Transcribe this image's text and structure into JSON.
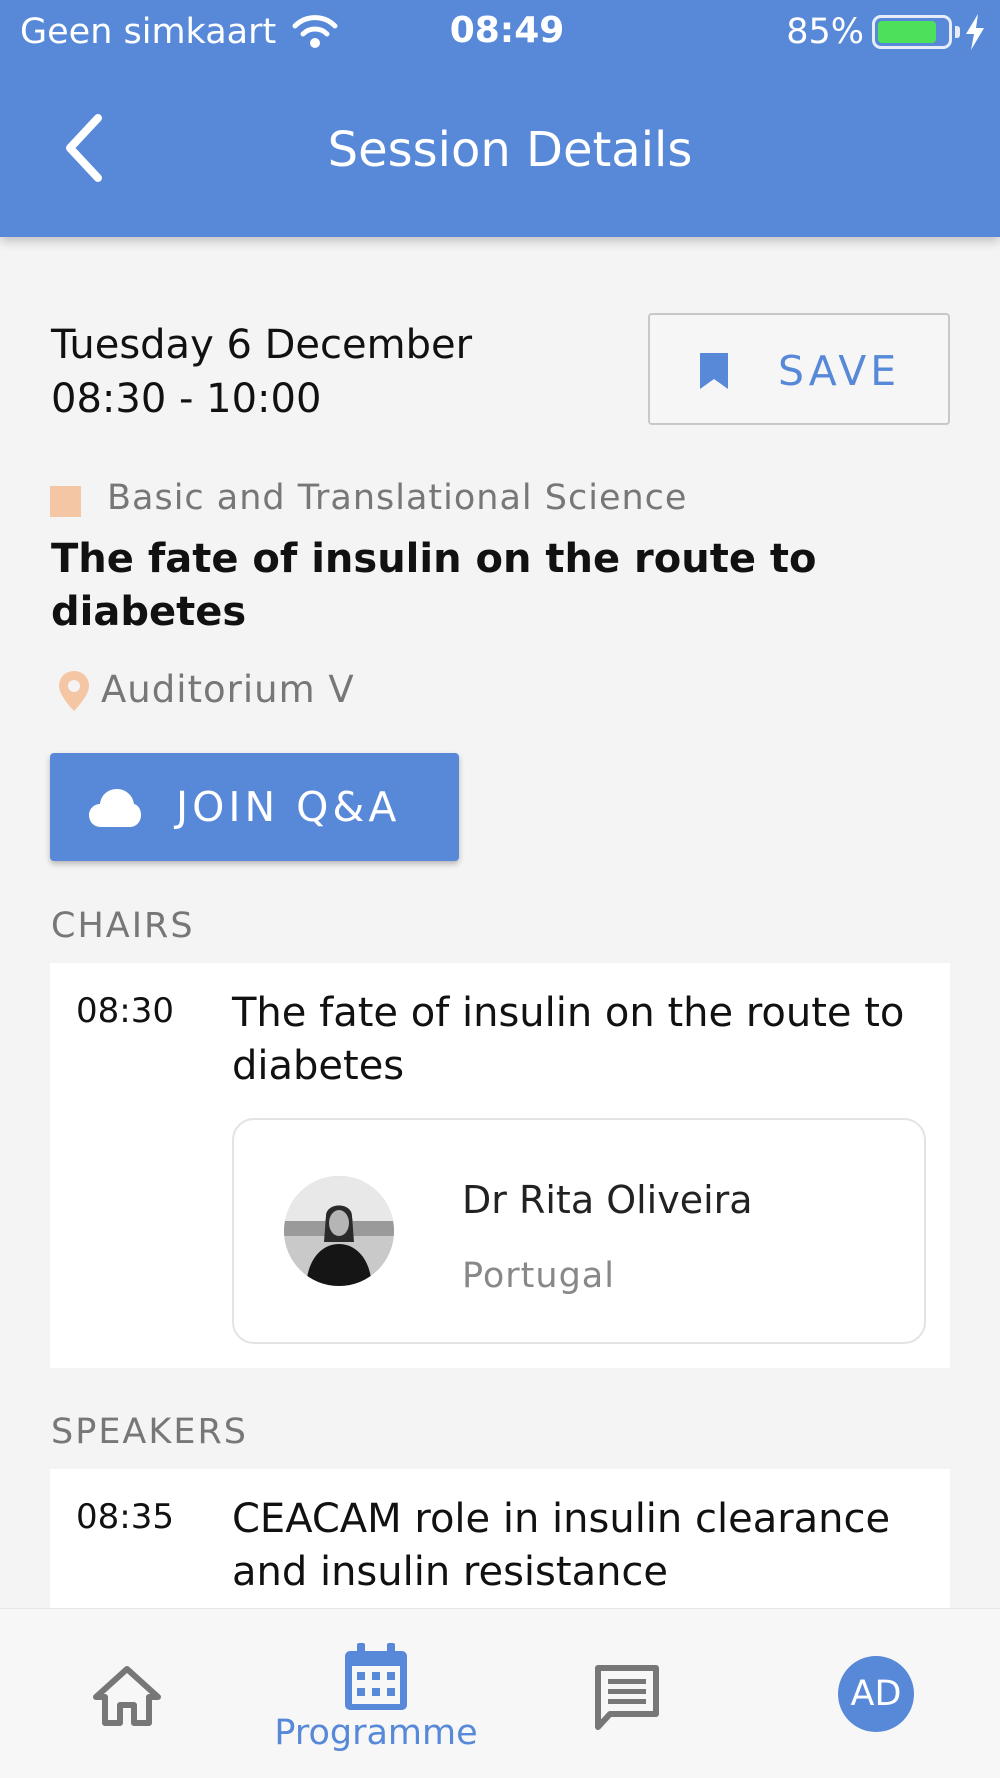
{
  "status_bar": {
    "carrier": "Geen simkaart",
    "time": "08:49",
    "battery_percent": "85%",
    "battery_level": 0.85
  },
  "header": {
    "title": "Session Details",
    "back_icon": "chevron-left-icon"
  },
  "session": {
    "date": "Tuesday 6 December",
    "time_range": "08:30 - 10:00",
    "save_label": "SAVE",
    "track": "Basic and Translational Science",
    "track_color": "#f5c6a4",
    "title": "The fate of insulin on the route to diabetes",
    "room": "Auditorium V",
    "qa_label": "JOIN Q&A"
  },
  "chairs": {
    "heading": "CHAIRS",
    "items": [
      {
        "time": "08:30",
        "title": "The fate of insulin on the route to diabetes",
        "person_name": "Dr Rita Oliveira",
        "person_country": "Portugal"
      }
    ]
  },
  "speakers": {
    "heading": "SPEAKERS",
    "items": [
      {
        "time": "08:35",
        "title": "CEACAM role in insulin clearance and insulin resistance"
      }
    ]
  },
  "tabbar": {
    "active_label": "Programme",
    "profile_initials": "AD",
    "accent": "#5789d8"
  }
}
